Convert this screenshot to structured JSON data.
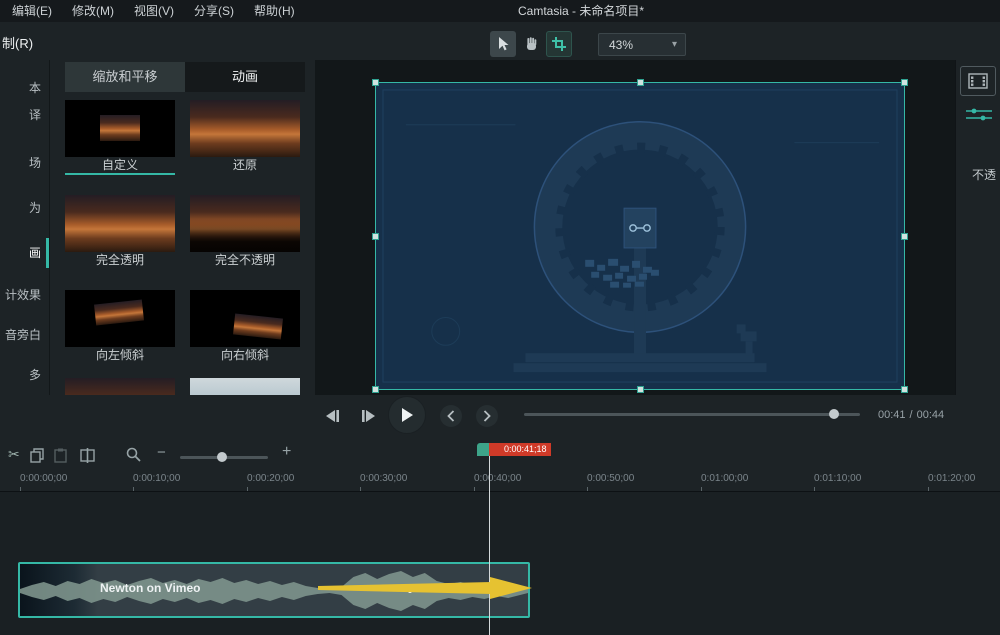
{
  "window": {
    "title": "Camtasia - 未命名项目*"
  },
  "menubar": {
    "items": [
      "编辑(E)",
      "修改(M)",
      "视图(V)",
      "分享(S)",
      "帮助(H)"
    ]
  },
  "toolbar": {
    "record_label": "制(R)",
    "zoom_value": "43%"
  },
  "sidebar": {
    "items": [
      "本",
      "译",
      "场",
      "为",
      "画",
      "计效果",
      "音旁白",
      "多"
    ],
    "active_item": "画"
  },
  "media_panel": {
    "tabs": [
      "缩放和平移",
      "动画"
    ],
    "active_tab": "动画",
    "animations": [
      "自定义",
      "还原",
      "完全透明",
      "完全不透明",
      "向左倾斜",
      "向右倾斜"
    ]
  },
  "right_panel": {
    "opacity_label": "不透"
  },
  "playback": {
    "current_time": "00:41",
    "separator": "/",
    "duration": "00:44"
  },
  "timeline": {
    "playhead_badge": "0:00:41;18",
    "ruler_ticks": [
      "0:00:00;00",
      "0:00:10;00",
      "0:00:20;00",
      "0:00:30;00",
      "0:00:40;00",
      "0:00:50;00",
      "0:01:00;00",
      "0:01:10;00",
      "0:01:20;00"
    ],
    "clip_label": "Newton on Vimeo"
  },
  "colors": {
    "accent": "#35b8a6",
    "playhead_red": "#cf3a28",
    "annotation_yellow": "#e6c231"
  }
}
